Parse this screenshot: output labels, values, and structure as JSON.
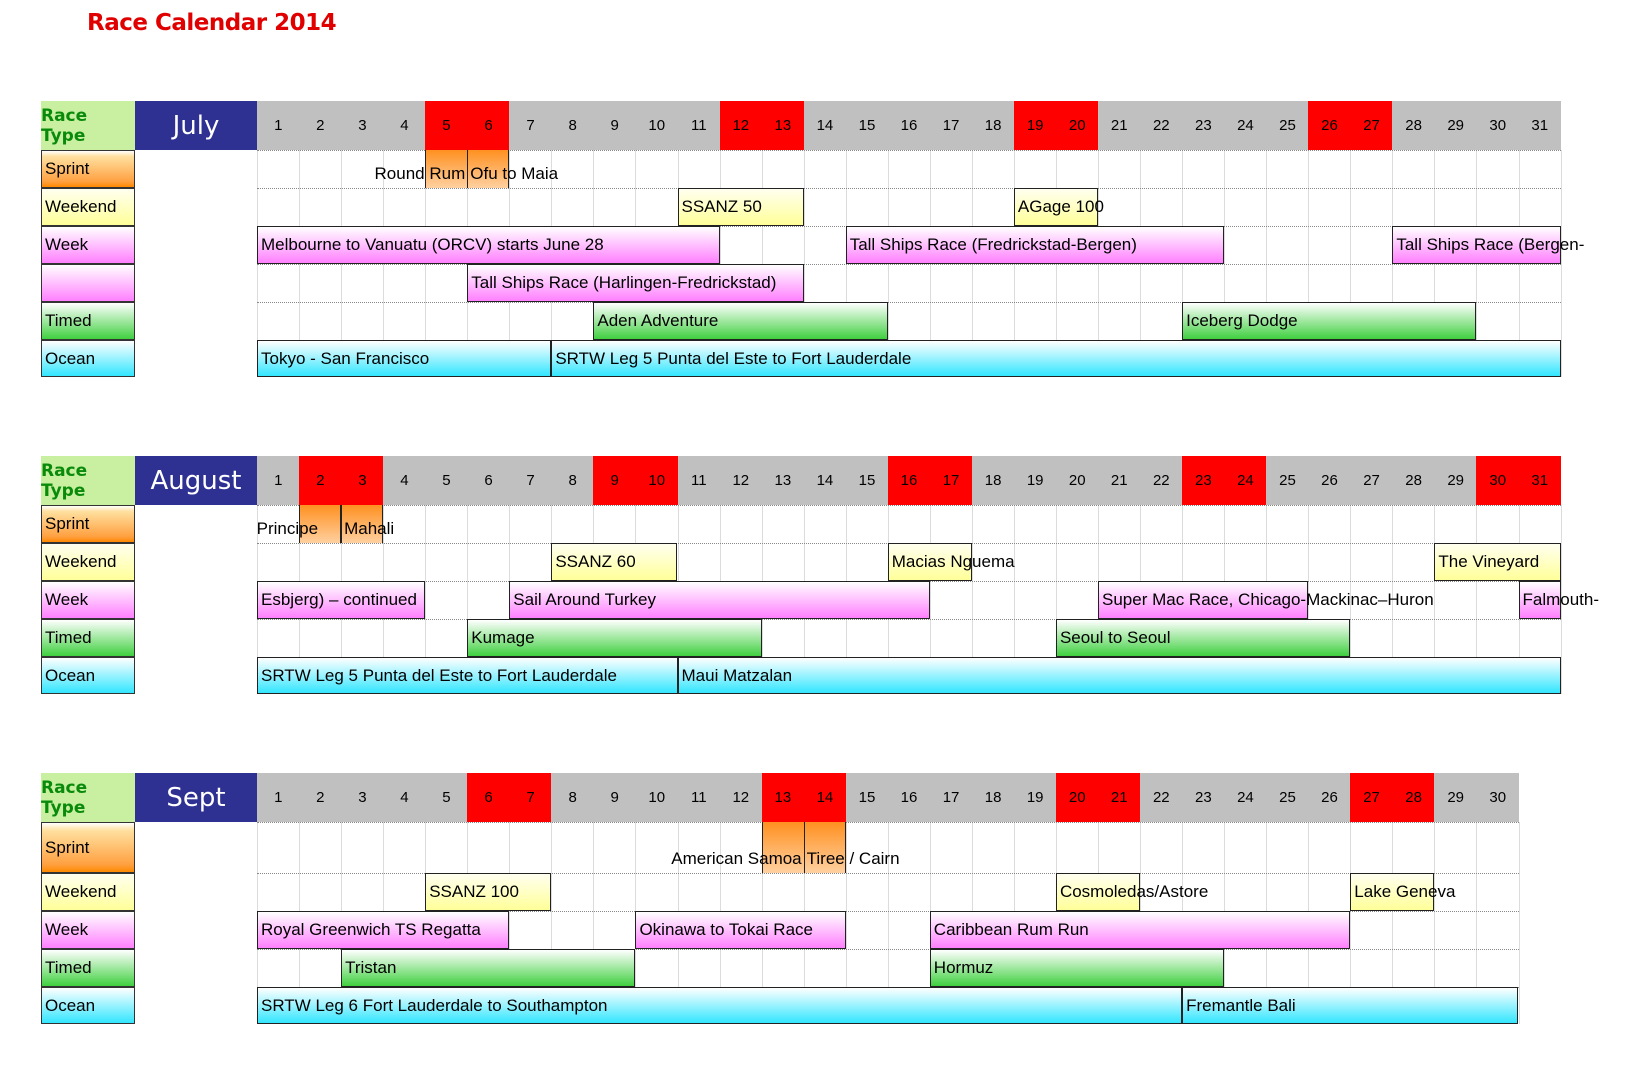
{
  "title": "Race Calendar 2014",
  "race_type_label": "Race Type",
  "row_labels": [
    "Sprint",
    "Weekend",
    "Week",
    "",
    "Timed",
    "Ocean"
  ],
  "months": [
    {
      "name": "July",
      "days": 31,
      "weekend_days": [
        5,
        6,
        12,
        13,
        19,
        20,
        26,
        27
      ],
      "rows": [
        "Sprint",
        "Weekend",
        "Week",
        "",
        "Timed",
        "Ocean"
      ],
      "events": [
        {
          "row": 0,
          "start": 5,
          "end": 6,
          "label": "Round Rum",
          "type": "sprint"
        },
        {
          "row": 0,
          "start": 6,
          "end": 6,
          "label": "Ofu to Maia",
          "type": "sprint"
        },
        {
          "row": 1,
          "start": 11,
          "end": 13,
          "label": "SSANZ 50",
          "type": "weekend"
        },
        {
          "row": 1,
          "start": 19,
          "end": 20,
          "label": "AGage 100",
          "type": "weekend"
        },
        {
          "row": 2,
          "start": 1,
          "end": 11,
          "label": "Melbourne to Vanuatu (ORCV) starts June 28",
          "type": "week"
        },
        {
          "row": 2,
          "start": 15,
          "end": 23,
          "label": "Tall Ships Race (Fredrickstad-Bergen)",
          "type": "week"
        },
        {
          "row": 2,
          "start": 28,
          "end": 31,
          "label": "Tall Ships Race (Bergen-",
          "type": "week"
        },
        {
          "row": 3,
          "start": 6,
          "end": 13,
          "label": "Tall Ships Race (Harlingen-Fredrickstad)",
          "type": "week"
        },
        {
          "row": 4,
          "start": 9,
          "end": 15,
          "label": "Aden Adventure",
          "type": "timed"
        },
        {
          "row": 4,
          "start": 23,
          "end": 29,
          "label": "Iceberg Dodge",
          "type": "timed"
        },
        {
          "row": 5,
          "start": 1,
          "end": 7,
          "label": "Tokyo - San Francisco",
          "type": "ocean"
        },
        {
          "row": 5,
          "start": 8,
          "end": 31,
          "label": "SRTW Leg 5 Punta del Este to Fort Lauderdale",
          "type": "ocean"
        }
      ]
    },
    {
      "name": "August",
      "days": 31,
      "weekend_days": [
        2,
        3,
        9,
        10,
        16,
        17,
        23,
        24,
        30,
        31
      ],
      "rows": [
        "Sprint",
        "Weekend",
        "Week",
        "Timed",
        "Ocean"
      ],
      "events": [
        {
          "row": 0,
          "start": 2,
          "end": 2,
          "label": "Principe",
          "type": "sprint"
        },
        {
          "row": 0,
          "start": 3,
          "end": 3,
          "label": "Mahali",
          "type": "sprint"
        },
        {
          "row": 1,
          "start": 8,
          "end": 10,
          "label": "SSANZ 60",
          "type": "weekend"
        },
        {
          "row": 1,
          "start": 16,
          "end": 17,
          "label": "Macias Nguema",
          "type": "weekend"
        },
        {
          "row": 1,
          "start": 29,
          "end": 31,
          "label": "The Vineyard",
          "type": "weekend"
        },
        {
          "row": 2,
          "start": 1,
          "end": 4,
          "label": "Esbjerg) – continued",
          "type": "week"
        },
        {
          "row": 2,
          "start": 7,
          "end": 16,
          "label": "Sail Around Turkey",
          "type": "week"
        },
        {
          "row": 2,
          "start": 21,
          "end": 25,
          "label": "Super Mac Race, Chicago-Mackinac–Huron",
          "type": "week"
        },
        {
          "row": 2,
          "start": 31,
          "end": 31,
          "label": "Falmouth-",
          "type": "week"
        },
        {
          "row": 3,
          "start": 6,
          "end": 12,
          "label": "Kumage",
          "type": "timed"
        },
        {
          "row": 3,
          "start": 20,
          "end": 26,
          "label": "Seoul to Seoul",
          "type": "timed"
        },
        {
          "row": 4,
          "start": 1,
          "end": 10,
          "label": "SRTW Leg 5 Punta del Este to Fort Lauderdale",
          "type": "ocean"
        },
        {
          "row": 4,
          "start": 11,
          "end": 31,
          "label": "Maui Matzalan",
          "type": "ocean"
        }
      ]
    },
    {
      "name": "Sept",
      "days": 30,
      "weekend_days": [
        6,
        7,
        13,
        14,
        20,
        21,
        27,
        28
      ],
      "rows": [
        "Sprint",
        "Weekend",
        "Week",
        "Timed",
        "Ocean"
      ],
      "events": [
        {
          "row": 0,
          "start": 13,
          "end": 14,
          "label": "American Samoa",
          "type": "sprint"
        },
        {
          "row": 0,
          "start": 14,
          "end": 14,
          "label": "Tiree / Cairn",
          "type": "sprint"
        },
        {
          "row": 1,
          "start": 5,
          "end": 7,
          "label": "SSANZ 100",
          "type": "weekend"
        },
        {
          "row": 1,
          "start": 20,
          "end": 21,
          "label": "Cosmoledas/Astore",
          "type": "weekend"
        },
        {
          "row": 1,
          "start": 27,
          "end": 28,
          "label": "Lake Geneva",
          "type": "weekend"
        },
        {
          "row": 2,
          "start": 1,
          "end": 6,
          "label": "Royal Greenwich TS Regatta",
          "type": "week"
        },
        {
          "row": 2,
          "start": 10,
          "end": 14,
          "label": "Okinawa to Tokai Race",
          "type": "week"
        },
        {
          "row": 2,
          "start": 17,
          "end": 26,
          "label": "Caribbean Rum Run",
          "type": "week"
        },
        {
          "row": 3,
          "start": 3,
          "end": 9,
          "label": "Tristan",
          "type": "timed"
        },
        {
          "row": 3,
          "start": 17,
          "end": 23,
          "label": "Hormuz",
          "type": "timed"
        },
        {
          "row": 4,
          "start": 1,
          "end": 22,
          "label": "SRTW Leg 6 Fort Lauderdale to Southampton",
          "type": "ocean"
        },
        {
          "row": 4,
          "start": 23,
          "end": 30,
          "label": "Fremantle Bali",
          "type": "ocean"
        }
      ]
    }
  ]
}
